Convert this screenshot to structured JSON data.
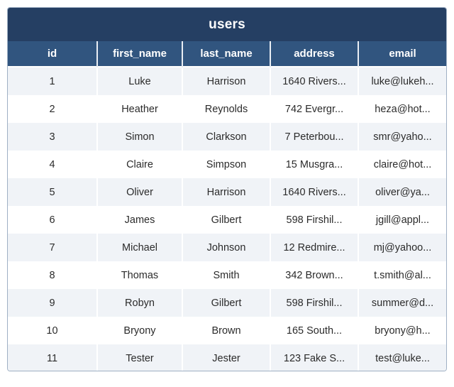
{
  "table": {
    "title": "users",
    "columns": [
      {
        "key": "id",
        "label": "id"
      },
      {
        "key": "first_name",
        "label": "first_name"
      },
      {
        "key": "last_name",
        "label": "last_name"
      },
      {
        "key": "address",
        "label": "address"
      },
      {
        "key": "email",
        "label": "email"
      }
    ],
    "rows": [
      {
        "id": "1",
        "first_name": "Luke",
        "last_name": "Harrison",
        "address": "1640 Rivers...",
        "email": "luke@lukeh..."
      },
      {
        "id": "2",
        "first_name": "Heather",
        "last_name": "Reynolds",
        "address": "742 Evergr...",
        "email": "heza@hot..."
      },
      {
        "id": "3",
        "first_name": "Simon",
        "last_name": "Clarkson",
        "address": "7 Peterbou...",
        "email": "smr@yaho..."
      },
      {
        "id": "4",
        "first_name": "Claire",
        "last_name": "Simpson",
        "address": "15 Musgra...",
        "email": "claire@hot..."
      },
      {
        "id": "5",
        "first_name": "Oliver",
        "last_name": "Harrison",
        "address": "1640 Rivers...",
        "email": "oliver@ya..."
      },
      {
        "id": "6",
        "first_name": "James",
        "last_name": "Gilbert",
        "address": "598 Firshil...",
        "email": "jgill@appl..."
      },
      {
        "id": "7",
        "first_name": "Michael",
        "last_name": "Johnson",
        "address": "12 Redmire...",
        "email": "mj@yahoo..."
      },
      {
        "id": "8",
        "first_name": "Thomas",
        "last_name": "Smith",
        "address": "342 Brown...",
        "email": "t.smith@al..."
      },
      {
        "id": "9",
        "first_name": "Robyn",
        "last_name": "Gilbert",
        "address": "598 Firshil...",
        "email": "summer@d..."
      },
      {
        "id": "10",
        "first_name": "Bryony",
        "last_name": "Brown",
        "address": "165 South...",
        "email": "bryony@h..."
      },
      {
        "id": "11",
        "first_name": "Tester",
        "last_name": "Jester",
        "address": "123 Fake S...",
        "email": "test@luke..."
      }
    ]
  },
  "colors": {
    "title_bar": "#253f63",
    "header_row": "#31557f",
    "row_stripe": "#f0f3f7",
    "row_plain": "#ffffff",
    "border": "#9fb0c4",
    "text": "#2b2b2b",
    "header_text": "#ffffff"
  }
}
